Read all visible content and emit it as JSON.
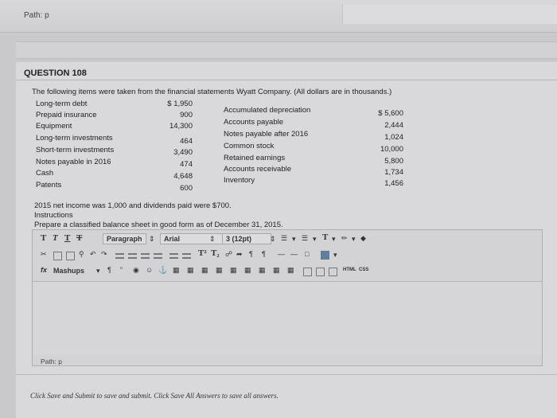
{
  "header": {
    "path_label": "Path: p"
  },
  "question": {
    "title": "QUESTION 108",
    "intro": "The following items were taken from the financial statements Wyatt Company. (All dollars are in thousands.)",
    "left_items": [
      {
        "label": "Long-term debt",
        "amount": "$ 1,950"
      },
      {
        "label": "Prepaid insurance",
        "amount": "900"
      },
      {
        "label": "Equipment",
        "amount": "14,300"
      },
      {
        "label": "Long-term investments",
        "amount": "464"
      },
      {
        "label": "Short-term investments",
        "amount": "3,490"
      },
      {
        "label": "Notes payable in 2016",
        "amount": "474"
      },
      {
        "label": "Cash",
        "amount": "4,648"
      },
      {
        "label": "Patents",
        "amount": "600"
      }
    ],
    "right_items": [
      {
        "label": "Accumulated depreciation",
        "amount": "$ 5,600"
      },
      {
        "label": "Accounts payable",
        "amount": "2,444"
      },
      {
        "label": "Notes payable after 2016",
        "amount": "1,024"
      },
      {
        "label": "Common stock",
        "amount": "10,000"
      },
      {
        "label": "Retained earnings",
        "amount": "5,800"
      },
      {
        "label": "Accounts receivable",
        "amount": "1,734"
      },
      {
        "label": "Inventory",
        "amount": "1,456"
      }
    ],
    "note1": "2015 net income was 1,000 and dividends paid were $700.",
    "note2": "Instructions",
    "note3": "Prepare a classified balance sheet in good form as of December 31, 2015."
  },
  "editor": {
    "format_glyphs": [
      "T",
      "T",
      "T",
      "T"
    ],
    "paragraph": "Paragraph",
    "font": "Arial",
    "size": "3 (12pt)",
    "fx": "fx",
    "mashups": "Mashups",
    "html_label": "HTML",
    "css_label": "CSS",
    "path_label": "Path: p"
  },
  "footer": {
    "instruction": "Click Save and Submit to save and submit. Click Save All Answers to save all answers."
  }
}
